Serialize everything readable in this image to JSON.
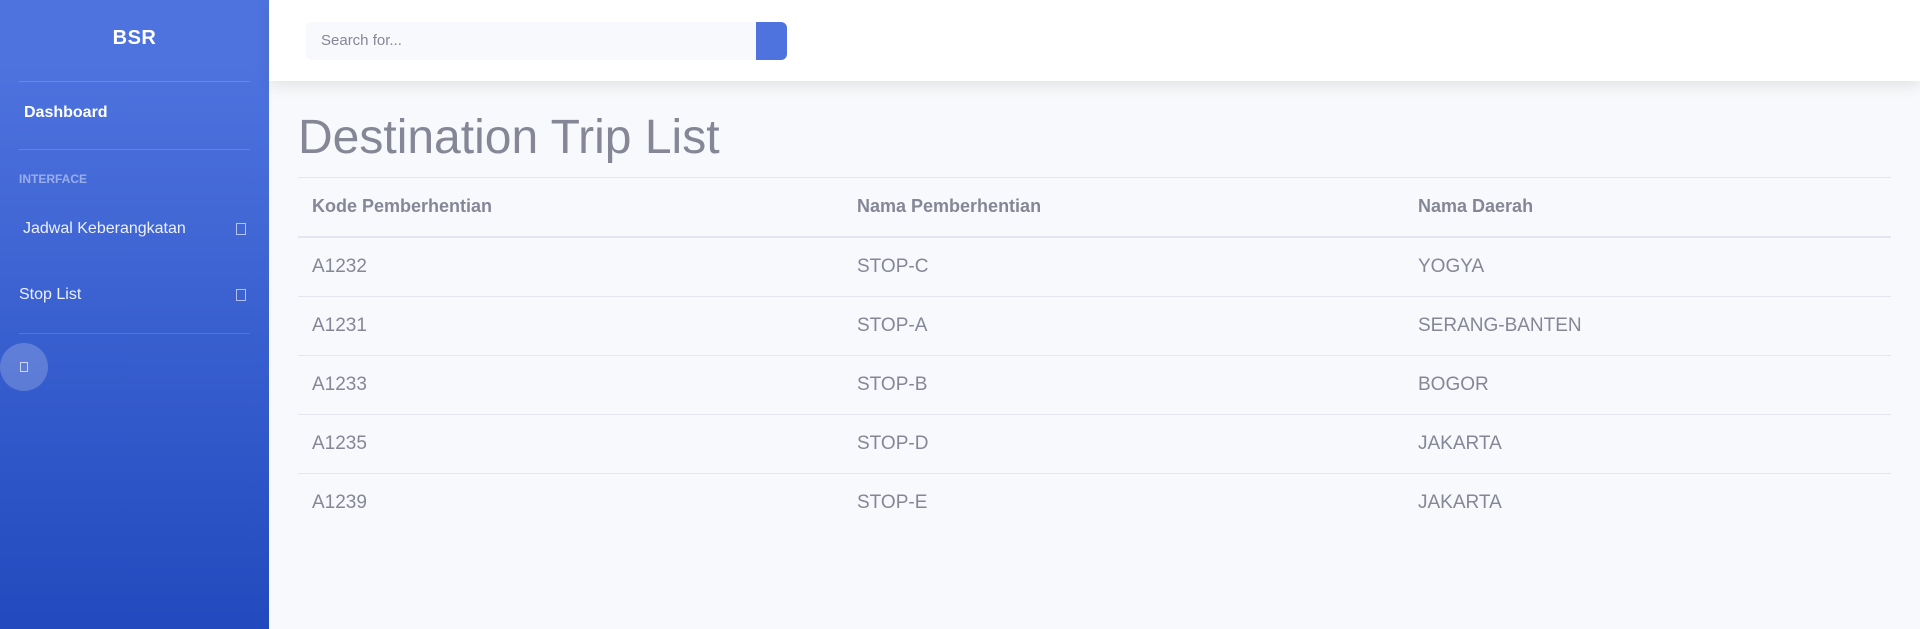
{
  "sidebar": {
    "brand": "BSR",
    "dashboard_label": "Dashboard",
    "heading": "INTERFACE",
    "items": [
      {
        "label": "Jadwal Keberangkatan",
        "icon": "chevron-right-icon"
      },
      {
        "label": "Stop List",
        "icon": "chevron-right-icon"
      }
    ],
    "toggle_icon": "sidebar-toggle-icon",
    "gradient_from": "#4e73df",
    "gradient_to": "#224abe"
  },
  "topbar": {
    "search": {
      "value": "",
      "placeholder": "Search for..."
    },
    "search_button_icon": "search-icon",
    "accent": "#4e73df"
  },
  "main": {
    "title": "Destination Trip List",
    "table": {
      "headers": [
        "Kode Pemberhentian",
        "Nama Pemberhentian",
        "Nama Daerah"
      ],
      "rows": [
        [
          "A1232",
          "STOP-C",
          "YOGYA"
        ],
        [
          "A1231",
          "STOP-A",
          "SERANG-BANTEN"
        ],
        [
          "A1233",
          "STOP-B",
          "BOGOR"
        ],
        [
          "A1235",
          "STOP-D",
          "JAKARTA"
        ],
        [
          "A1239",
          "STOP-E",
          "JAKARTA"
        ]
      ]
    }
  }
}
